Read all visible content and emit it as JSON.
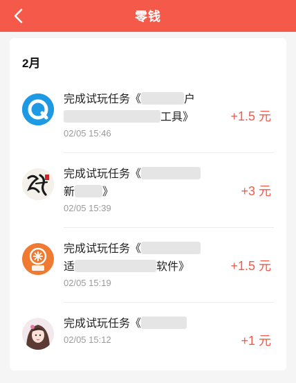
{
  "header": {
    "title": "零钱",
    "back_icon": "chevron-left-icon",
    "color": "#f4594a"
  },
  "list": {
    "month": "2月",
    "items": [
      {
        "line1": "完成试玩任务《",
        "line1_tail": "户",
        "line2_head": "",
        "line2_tail": "工具》",
        "time": "02/05 15:46",
        "amount": "+1.5 元",
        "icon": "q-app-icon"
      },
      {
        "line1": "完成试玩任务《",
        "line1_tail": "",
        "line2_head": "新",
        "line2_tail": "》",
        "time": "02/05 15:39",
        "amount": "+3 元",
        "icon": "game-calligraphy-icon"
      },
      {
        "line1": "完成试玩任务《",
        "line1_tail": "",
        "line2_head": "适",
        "line2_tail": "软件》",
        "time": "02/05 15:19",
        "amount": "+1.5 元",
        "icon": "loan-app-icon"
      },
      {
        "line1": "完成试玩任务《",
        "line1_tail": "",
        "line2_head": "",
        "line2_tail": "",
        "time": "02/05 15:12",
        "amount": "+1 元",
        "icon": "girl-avatar-icon"
      }
    ]
  }
}
